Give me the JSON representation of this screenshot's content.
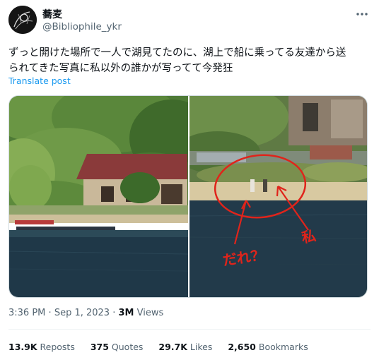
{
  "author": {
    "display_name": "蕎麦",
    "handle": "@Bibliophile_ykr"
  },
  "post": {
    "text": "ずっと開けた場所で一人で湖見てたのに、湖上で船に乗ってる友達から送\nられてきた写真に私以外の誰かが写ってて今発狂",
    "translate_label": "Translate post"
  },
  "media": {
    "annotation_who": "だれ？",
    "annotation_me": "私"
  },
  "meta": {
    "time": "3:36 PM",
    "separator": "·",
    "date": "Sep 1, 2023",
    "views_count": "3M",
    "views_label": "Views"
  },
  "stats": {
    "reposts_count": "13.9K",
    "reposts_label": "Reposts",
    "quotes_count": "375",
    "quotes_label": "Quotes",
    "likes_count": "29.7K",
    "likes_label": "Likes",
    "bookmarks_count": "2,650",
    "bookmarks_label": "Bookmarks"
  },
  "icons": {
    "more": "more-dots-icon"
  },
  "colors": {
    "link": "#1d9bf0",
    "secondary_text": "#536471",
    "annotation_red": "#e0241b"
  }
}
